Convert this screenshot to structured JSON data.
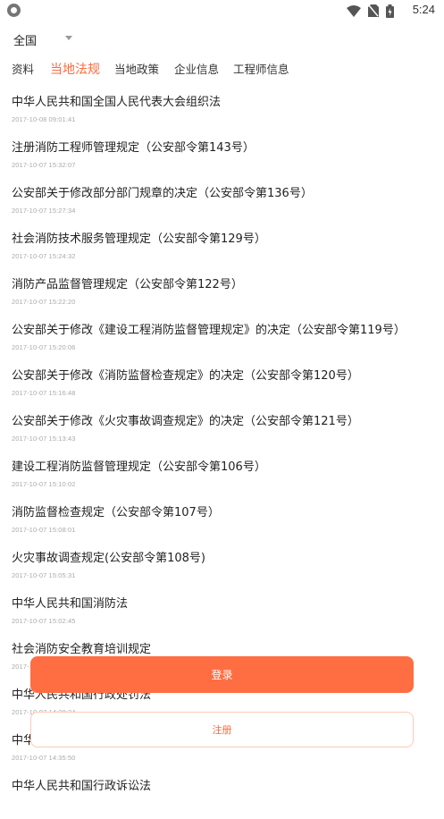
{
  "status_bar": {
    "time": "5:24"
  },
  "region": {
    "selected": "全国"
  },
  "tabs": [
    {
      "label": "资料"
    },
    {
      "label": "当地法规"
    },
    {
      "label": "当地政策"
    },
    {
      "label": "企业信息"
    },
    {
      "label": "工程师信息"
    }
  ],
  "active_tab": "当地法规",
  "articles": [
    {
      "title": "中华人民共和国全国人民代表大会组织法",
      "time": "2017-10-08 09:01:41"
    },
    {
      "title": "注册消防工程师管理规定（公安部令第143号）",
      "time": "2017-10-07 15:32:07"
    },
    {
      "title": "公安部关于修改部分部门规章的决定（公安部令第136号）",
      "time": "2017-10-07 15:27:34"
    },
    {
      "title": "社会消防技术服务管理规定（公安部令第129号）",
      "time": "2017-10-07 15:24:32"
    },
    {
      "title": "消防产品监督管理规定（公安部令第122号）",
      "time": "2017-10-07 15:22:20"
    },
    {
      "title": "公安部关于修改《建设工程消防监督管理规定》的决定（公安部令第119号）",
      "time": "2017-10-07 15:20:06"
    },
    {
      "title": "公安部关于修改《消防监督检查规定》的决定（公安部令第120号）",
      "time": "2017-10-07 15:16:48"
    },
    {
      "title": "公安部关于修改《火灾事故调查规定》的决定（公安部令第121号）",
      "time": "2017-10-07 15:13:43"
    },
    {
      "title": "建设工程消防监督管理规定（公安部令第106号）",
      "time": "2017-10-07 15:10:02"
    },
    {
      "title": "消防监督检查规定（公安部令第107号）",
      "time": "2017-10-07 15:08:01"
    },
    {
      "title": "火灾事故调查规定(公安部令第108号)",
      "time": "2017-10-07 15:05:31"
    },
    {
      "title": "中华人民共和国消防法",
      "time": "2017-10-07 15:02:45"
    },
    {
      "title": "社会消防安全教育培训规定",
      "time": "2017-"
    },
    {
      "title": "中华人民共和国行政处罚法",
      "time": "2017-10-07 14:38:24"
    },
    {
      "title": "中华",
      "time": "2017-10-07 14:35:50"
    },
    {
      "title": "中华人民共和国行政诉讼法",
      "time": ""
    }
  ],
  "buttons": {
    "login": "登录",
    "register": "注册"
  },
  "colors": {
    "accent": "#ff6a3c",
    "button_fill": "#ff6e42"
  }
}
